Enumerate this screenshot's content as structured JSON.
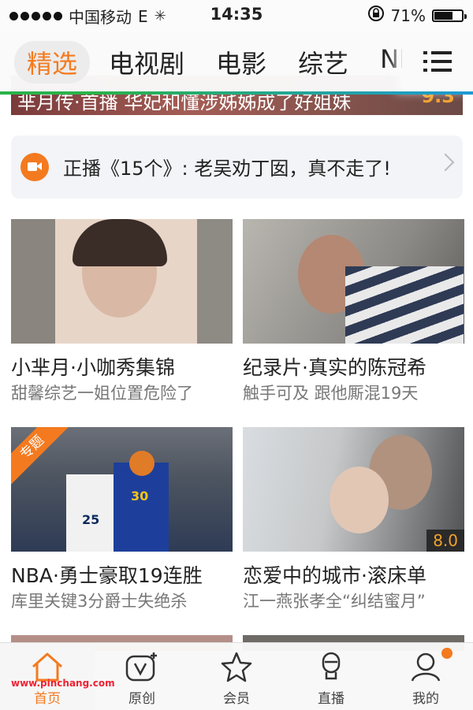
{
  "status_bar": {
    "carrier": "中国移动",
    "network": "E",
    "time": "14:35",
    "battery": "71%",
    "battery_level": 0.71
  },
  "tabs": [
    {
      "label": "精选",
      "active": true
    },
    {
      "label": "电视剧",
      "active": false
    },
    {
      "label": "电影",
      "active": false
    },
    {
      "label": "综艺",
      "active": false
    },
    {
      "label": "NBA",
      "active": false
    }
  ],
  "banner": {
    "title": "芈月传·首播 华妃和懂涉姊姊成了好姐妹",
    "score": "9.3"
  },
  "now_playing": {
    "text": "正播《15个》: 老吴劝丁囡，真不走了!"
  },
  "cards": [
    {
      "title": "小芈月·小咖秀集锦",
      "subtitle": "甜馨综艺一姐位置危险了"
    },
    {
      "title": "纪录片·真实的陈冠希",
      "subtitle": "触手可及 跟他厮混19天"
    },
    {
      "title": "NBA·勇士豪取19连胜",
      "subtitle": "库里关键3分爵士失绝杀",
      "tag": "专题"
    },
    {
      "title": "恋爱中的城市·滚床单",
      "subtitle": "江一燕张孝全“纠结蜜月”",
      "score": "8.0"
    }
  ],
  "bottom_nav": [
    {
      "label": "首页",
      "icon": "home-icon",
      "active": true
    },
    {
      "label": "原创",
      "icon": "original-v-icon",
      "active": false
    },
    {
      "label": "会员",
      "icon": "star-icon",
      "active": false
    },
    {
      "label": "直播",
      "icon": "microphone-icon",
      "active": false
    },
    {
      "label": "我的",
      "icon": "user-icon",
      "active": false
    }
  ],
  "watermark": "www.pinchang.com",
  "colors": {
    "accent": "#f47a1f",
    "score": "#f3a12c"
  }
}
